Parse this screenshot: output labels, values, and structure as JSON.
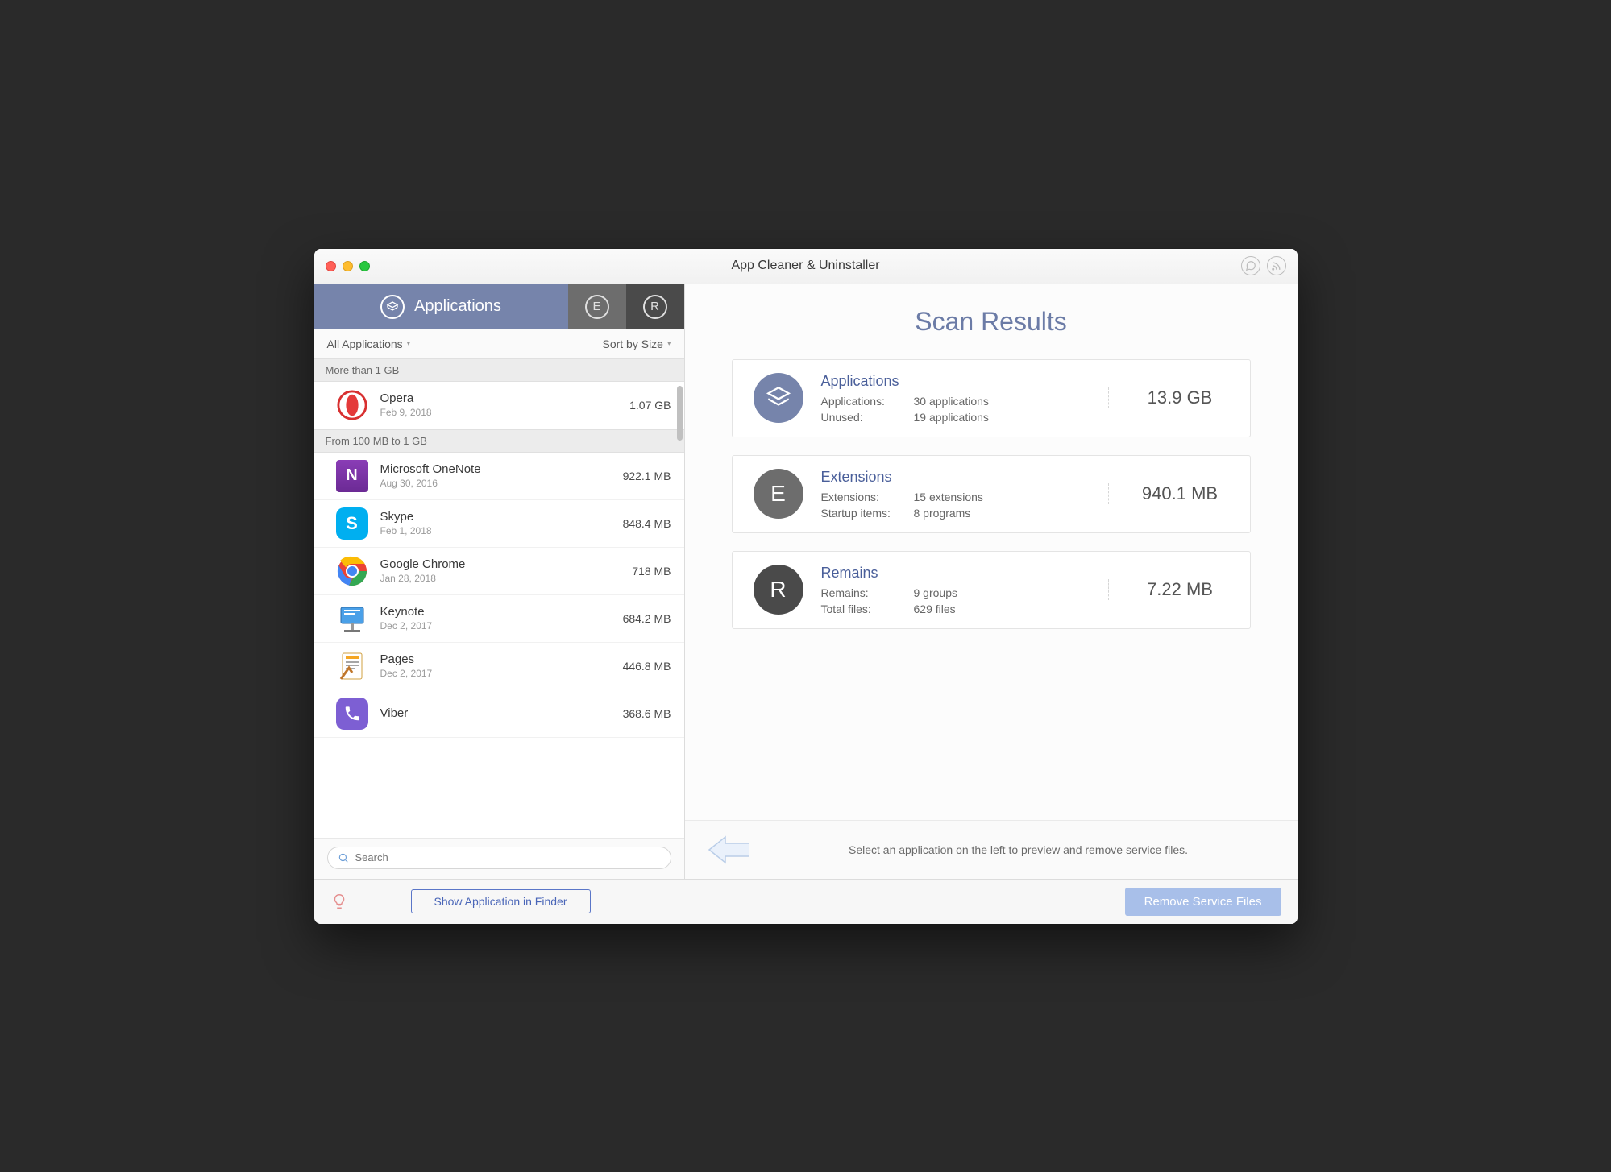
{
  "window": {
    "title": "App Cleaner & Uninstaller"
  },
  "tabs": {
    "applications": "Applications",
    "e_letter": "E",
    "r_letter": "R"
  },
  "filters": {
    "all": "All Applications",
    "sort": "Sort by Size"
  },
  "groups": [
    {
      "label": "More than 1 GB"
    },
    {
      "label": "From 100 MB to 1 GB"
    }
  ],
  "apps_g0": [
    {
      "name": "Opera",
      "date": "Feb 9, 2018",
      "size": "1.07 GB",
      "icon": "opera"
    }
  ],
  "apps_g1": [
    {
      "name": "Microsoft OneNote",
      "date": "Aug 30, 2016",
      "size": "922.1 MB",
      "icon": "onenote"
    },
    {
      "name": "Skype",
      "date": "Feb 1, 2018",
      "size": "848.4 MB",
      "icon": "skype"
    },
    {
      "name": "Google Chrome",
      "date": "Jan 28, 2018",
      "size": "718 MB",
      "icon": "chrome"
    },
    {
      "name": "Keynote",
      "date": "Dec 2, 2017",
      "size": "684.2 MB",
      "icon": "keynote"
    },
    {
      "name": "Pages",
      "date": "Dec 2, 2017",
      "size": "446.8 MB",
      "icon": "pages"
    },
    {
      "name": "Viber",
      "date": "",
      "size": "368.6 MB",
      "icon": "viber"
    }
  ],
  "search": {
    "placeholder": "Search"
  },
  "scan": {
    "title": "Scan Results",
    "cards": {
      "applications": {
        "title": "Applications",
        "row1_label": "Applications:",
        "row1_value": "30 applications",
        "row2_label": "Unused:",
        "row2_value": "19 applications",
        "size": "13.9 GB"
      },
      "extensions": {
        "title": "Extensions",
        "row1_label": "Extensions:",
        "row1_value": "15 extensions",
        "row2_label": "Startup items:",
        "row2_value": "8 programs",
        "size": "940.1 MB"
      },
      "remains": {
        "title": "Remains",
        "row1_label": "Remains:",
        "row1_value": "9 groups",
        "row2_label": "Total files:",
        "row2_value": "629 files",
        "size": "7.22 MB"
      }
    },
    "hint": "Select an application on the left to preview and remove service files."
  },
  "footer": {
    "show_in_finder": "Show Application in Finder",
    "remove": "Remove Service Files"
  }
}
